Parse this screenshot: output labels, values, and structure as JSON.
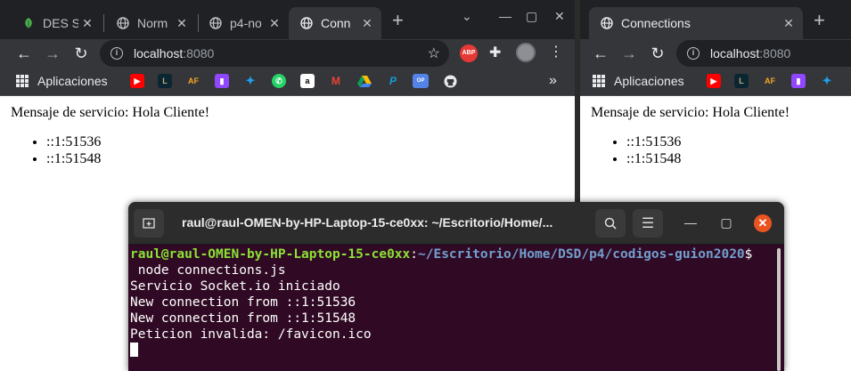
{
  "window1": {
    "tabs": [
      {
        "title": "DES S",
        "favicon": "leaf-icon"
      },
      {
        "title": "Norm",
        "favicon": "globe-icon"
      },
      {
        "title": "p4-no",
        "favicon": "globe-icon"
      },
      {
        "title": "Conn",
        "favicon": "globe-icon",
        "active": true
      }
    ],
    "url_host": "localhost",
    "url_port": ":8080",
    "bookmarks_apps_label": "Aplicaciones",
    "page": {
      "message": "Mensaje de servicio: Hola Cliente!",
      "connections": [
        "::1:51536",
        "::1:51548"
      ]
    }
  },
  "window2": {
    "tab_title": "Connections",
    "url_host": "localhost",
    "url_port": ":8080",
    "bookmarks_apps_label": "Aplicaciones",
    "page": {
      "message": "Mensaje de servicio: Hola Cliente!",
      "connections": [
        "::1:51536",
        "::1:51548"
      ]
    }
  },
  "bookmark_icons": [
    "youtube-icon",
    "lol-icon",
    "af-icon",
    "twitch-icon",
    "twitter-icon",
    "whatsapp-icon",
    "amazon-icon",
    "gmail-icon",
    "drive-icon",
    "paypal-icon",
    "opgg-icon",
    "github-icon"
  ],
  "extensions": {
    "abp_label": "ABP"
  },
  "terminal": {
    "title": "raul@raul-OMEN-by-HP-Laptop-15-ce0xx: ~/Escritorio/Home/...",
    "prompt_user": "raul@raul-OMEN-by-HP-Laptop-15-ce0xx",
    "prompt_sep": ":",
    "prompt_path": "~/Escritorio/Home/DSD/p4/codigos-guion2020",
    "prompt_symbol": "$",
    "command": " node connections.js",
    "output": [
      "Servicio Socket.io iniciado",
      "New connection from ::1:51536",
      "New connection from ::1:51548",
      "Peticion invalida: /favicon.ico"
    ]
  }
}
